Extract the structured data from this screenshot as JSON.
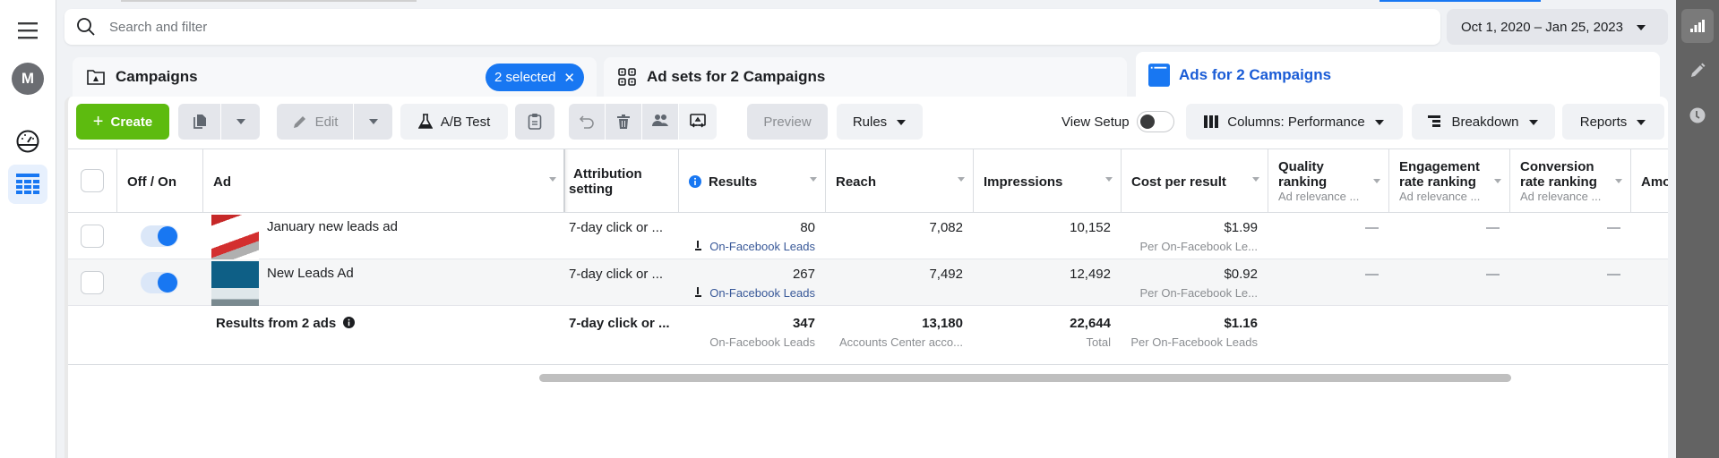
{
  "search": {
    "placeholder": "Search and filter"
  },
  "date_range": {
    "label": "Oct 1, 2020 – Jan 25, 2023"
  },
  "left_nav": {
    "avatar_initial": "M",
    "items": [
      "menu-icon",
      "avatar",
      "gauge-icon",
      "table-icon"
    ]
  },
  "right_strip": {
    "items": [
      "chart-icon",
      "pencil-icon",
      "clock-icon"
    ]
  },
  "level_tabs": {
    "campaigns": {
      "label": "Campaigns",
      "selected_badge": "2 selected",
      "clear": "✕"
    },
    "adsets": {
      "label": "Ad sets for 2 Campaigns"
    },
    "ads": {
      "label": "Ads for 2 Campaigns"
    }
  },
  "toolbar": {
    "create": "Create",
    "edit": "Edit",
    "ab_test": "A/B Test",
    "preview": "Preview",
    "rules": "Rules",
    "view_setup": "View Setup",
    "columns": "Columns: Performance",
    "breakdown": "Breakdown",
    "reports": "Reports"
  },
  "table": {
    "headers": {
      "off_on": "Off / On",
      "ad": "Ad",
      "attribution_1": "Attribution",
      "attribution_2": "setting",
      "results": "Results",
      "reach": "Reach",
      "impressions": "Impressions",
      "cost_per_result": "Cost per result",
      "quality_1": "Quality",
      "quality_2": "ranking",
      "quality_sub": "Ad relevance ...",
      "engagement_1": "Engagement",
      "engagement_2": "rate ranking",
      "engagement_sub": "Ad relevance ...",
      "conversion_1": "Conversion",
      "conversion_2": "rate ranking",
      "conversion_sub": "Ad relevance ...",
      "amount": "Amo"
    },
    "rows": [
      {
        "enabled": true,
        "ad": "January new leads ad",
        "attribution": "7-day click or ...",
        "results": "80",
        "results_type": "On-Facebook Leads",
        "reach": "7,082",
        "impressions": "10,152",
        "cost_per_result": "$1.99",
        "cost_sub": "Per On-Facebook Le...",
        "quality": "—",
        "engagement": "—",
        "conversion": "—"
      },
      {
        "enabled": true,
        "ad": "New Leads Ad",
        "attribution": "7-day click or ...",
        "results": "267",
        "results_type": "On-Facebook Leads",
        "reach": "7,492",
        "impressions": "12,492",
        "cost_per_result": "$0.92",
        "cost_sub": "Per On-Facebook Le...",
        "quality": "—",
        "engagement": "—",
        "conversion": "—"
      }
    ],
    "total": {
      "label": "Results from 2 ads",
      "attribution": "7-day click or ...",
      "results": "347",
      "results_sub": "On-Facebook Leads",
      "reach": "13,180",
      "reach_sub": "Accounts Center acco...",
      "impressions": "22,644",
      "impressions_sub": "Total",
      "cost_per_result": "$1.16",
      "cost_sub": "Per On-Facebook Leads"
    }
  },
  "colors": {
    "accent": "#1877f2",
    "create_green": "#5dbb0f",
    "ads_tab_text": "#1a5cd6"
  }
}
